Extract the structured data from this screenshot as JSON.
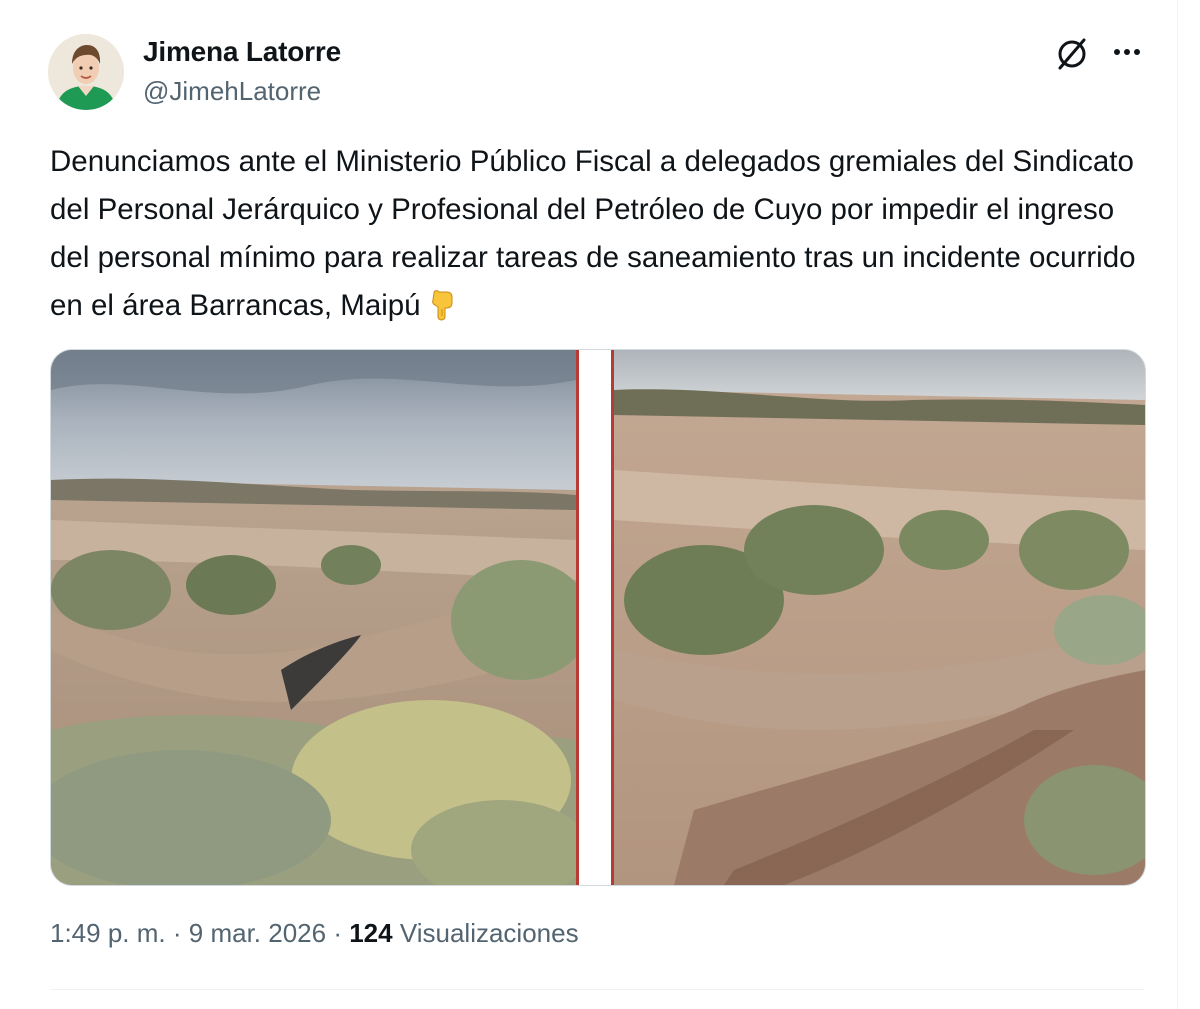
{
  "author": {
    "name": "Jimena Latorre",
    "handle": "@JimehLatorre"
  },
  "tweet": {
    "text": "Denunciamos ante el Ministerio Público Fiscal a delegados gremiales del Sindicato del Personal Jerárquico y Profesional del Petróleo de Cuyo por impedir el ingreso del personal mínimo para realizar tareas de saneamiento tras un incidente ocurrido en el área Barrancas, Maipú",
    "emoji": "backhand-index-pointing-down-icon"
  },
  "media": {
    "photos": [
      "photo-ravine-left",
      "photo-ravine-right"
    ]
  },
  "meta": {
    "time": "1:49 p. m.",
    "date": "9 mar. 2026",
    "separator": "·",
    "views_count": "124",
    "views_label": "Visualizaciones"
  },
  "icons": {
    "grok": "grok-icon",
    "more": "more-icon"
  }
}
